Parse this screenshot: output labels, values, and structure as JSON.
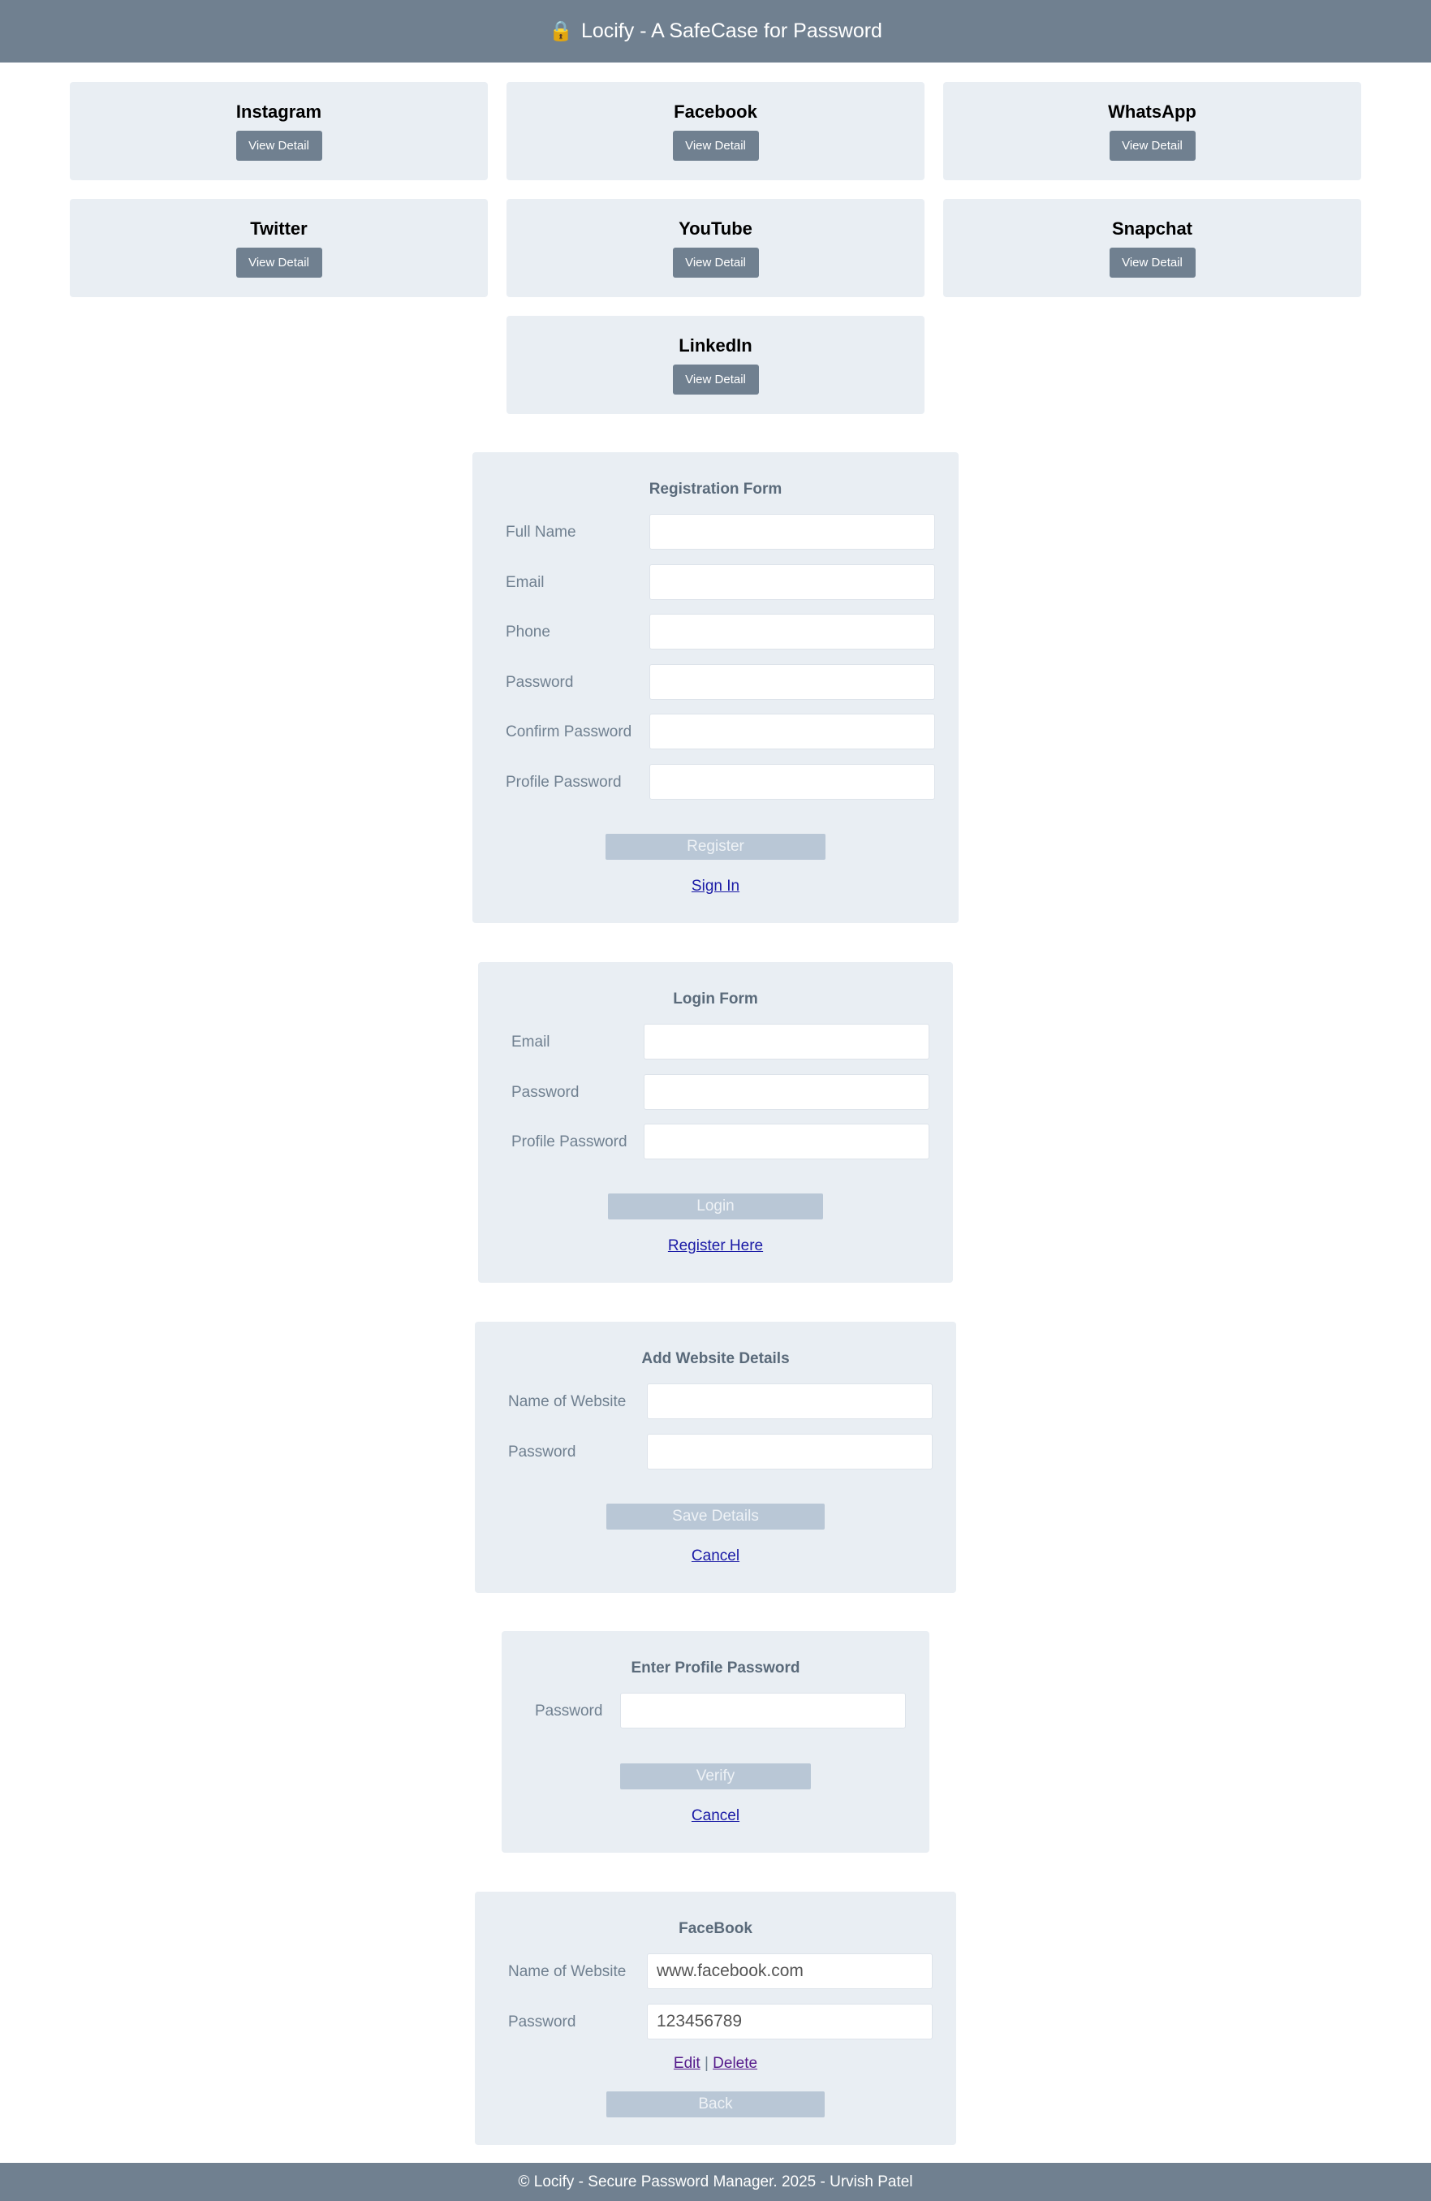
{
  "header": {
    "lock_icon": "🔒",
    "title": "Locify - A SafeCase for Password"
  },
  "cards": [
    {
      "name": "Instagram",
      "button": "View Detail"
    },
    {
      "name": "Facebook",
      "button": "View Detail"
    },
    {
      "name": "WhatsApp",
      "button": "View Detail"
    },
    {
      "name": "Twitter",
      "button": "View Detail"
    },
    {
      "name": "YouTube",
      "button": "View Detail"
    },
    {
      "name": "Snapchat",
      "button": "View Detail"
    },
    {
      "name": "LinkedIn",
      "button": "View Detail"
    }
  ],
  "registration": {
    "title": "Registration Form",
    "fields": [
      {
        "label": "Full Name",
        "value": ""
      },
      {
        "label": "Email",
        "value": ""
      },
      {
        "label": "Phone",
        "value": ""
      },
      {
        "label": "Password",
        "value": ""
      },
      {
        "label": "Confirm Password",
        "value": ""
      },
      {
        "label": "Profile Password",
        "value": ""
      }
    ],
    "submit": "Register",
    "link": "Sign In"
  },
  "login": {
    "title": "Login Form",
    "fields": [
      {
        "label": "Email",
        "value": ""
      },
      {
        "label": "Password",
        "value": ""
      },
      {
        "label": "Profile Password",
        "value": ""
      }
    ],
    "submit": "Login",
    "link": "Register Here"
  },
  "add_website": {
    "title": "Add Website Details",
    "fields": [
      {
        "label": "Name of Website",
        "value": ""
      },
      {
        "label": "Password",
        "value": ""
      }
    ],
    "submit": "Save Details",
    "link": "Cancel"
  },
  "profile_password": {
    "title": "Enter Profile Password",
    "fields": [
      {
        "label": "Password",
        "value": ""
      }
    ],
    "submit": "Verify",
    "link": "Cancel"
  },
  "detail": {
    "title": "FaceBook",
    "fields": [
      {
        "label": "Name of Website",
        "value": "www.facebook.com"
      },
      {
        "label": "Password",
        "value": "123456789"
      }
    ],
    "edit": "Edit",
    "separator": "|",
    "delete": "Delete",
    "submit": "Back"
  },
  "footer": {
    "text": "© Locify - Secure Password Manager. 2025 - Urvish Patel"
  }
}
